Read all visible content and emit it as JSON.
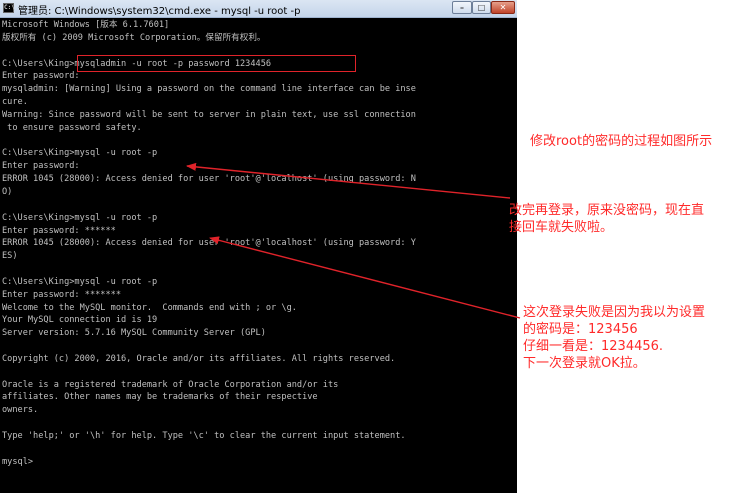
{
  "window": {
    "title": "管理员: C:\\Windows\\system32\\cmd.exe - mysql  -u root -p",
    "app_icon_glyph": "C:\\",
    "minimize_glyph": "–",
    "maximize_glyph": "□",
    "close_glyph": "✕"
  },
  "console": {
    "lines": [
      "Microsoft Windows [版本 6.1.7601]",
      "版权所有 (c) 2009 Microsoft Corporation。保留所有权利。",
      "",
      "C:\\Users\\King>mysqladmin -u root -p password 1234456",
      "Enter password:",
      "mysqladmin: [Warning] Using a password on the command line interface can be inse",
      "cure.",
      "Warning: Since password will be sent to server in plain text, use ssl connection",
      " to ensure password safety.",
      "",
      "C:\\Users\\King>mysql -u root -p",
      "Enter password:",
      "ERROR 1045 (28000): Access denied for user 'root'@'localhost' (using password: N",
      "O)",
      "",
      "C:\\Users\\King>mysql -u root -p",
      "Enter password: ******",
      "ERROR 1045 (28000): Access denied for user 'root'@'localhost' (using password: Y",
      "ES)",
      "",
      "C:\\Users\\King>mysql -u root -p",
      "Enter password: *******",
      "Welcome to the MySQL monitor.  Commands end with ; or \\g.",
      "Your MySQL connection id is 19",
      "Server version: 5.7.16 MySQL Community Server (GPL)",
      "",
      "Copyright (c) 2000, 2016, Oracle and/or its affiliates. All rights reserved.",
      "",
      "Oracle is a registered trademark of Oracle Corporation and/or its",
      "affiliates. Other names may be trademarks of their respective",
      "owners.",
      "",
      "Type 'help;' or '\\h' for help. Type '\\c' to clear the current input statement.",
      "",
      "mysql>"
    ]
  },
  "annotations": {
    "note1": [
      "修改root的密码的过程如图所示"
    ],
    "note2": [
      "改完再登录，原来没密码，现在直",
      "接回车就失败啦。"
    ],
    "note3": [
      "这次登录失败是因为我以为设置",
      "的密码是：123456",
      "仔细一看是：1234456.",
      "下一次登录就OK拉。"
    ],
    "color": "#ff2a2a"
  }
}
